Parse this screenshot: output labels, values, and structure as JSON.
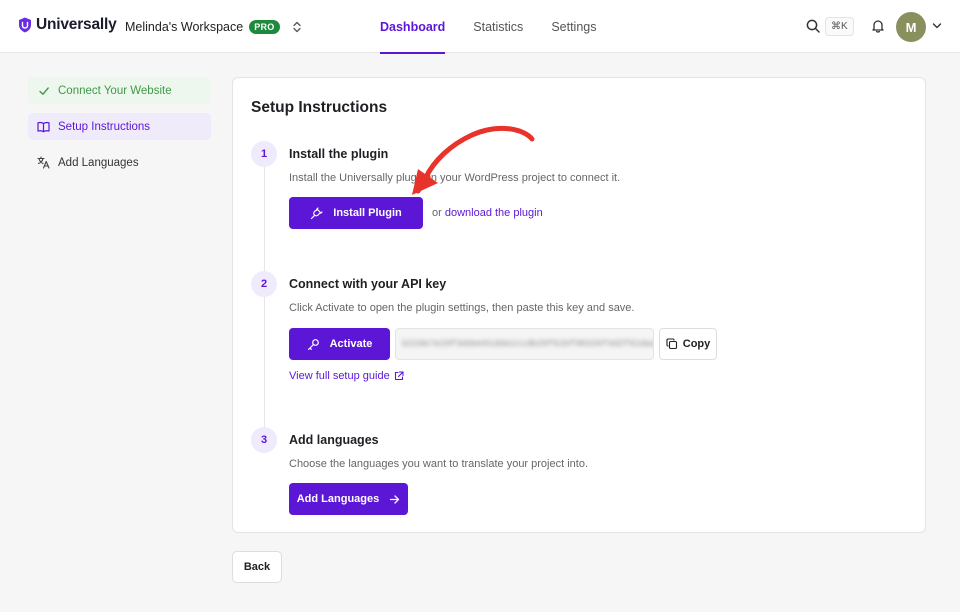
{
  "app": {
    "name": "Universally",
    "brand_color": "#5b16d6"
  },
  "workspace": {
    "name": "Melinda's Workspace",
    "badge": "PRO"
  },
  "nav": {
    "tabs": [
      {
        "label": "Dashboard",
        "active": true
      },
      {
        "label": "Statistics",
        "active": false
      },
      {
        "label": "Settings",
        "active": false
      }
    ]
  },
  "header": {
    "shortcut": "⌘K",
    "avatar_initial": "M"
  },
  "sidebar": {
    "items": [
      {
        "label": "Connect Your Website",
        "state": "done",
        "icon": "check-icon"
      },
      {
        "label": "Setup Instructions",
        "state": "active",
        "icon": "book-icon"
      },
      {
        "label": "Add Languages",
        "state": "default",
        "icon": "translate-icon"
      }
    ]
  },
  "main": {
    "title": "Setup Instructions",
    "steps": [
      {
        "number": "1",
        "title": "Install the plugin",
        "description": "Install the Universally plugin in your WordPress project to connect it.",
        "button_label": "Install Plugin",
        "alt_prefix": "or",
        "alt_link": "download the plugin"
      },
      {
        "number": "2",
        "title": "Connect with your API key",
        "description": "Click Activate to open the plugin settings, then paste this key and save.",
        "button_label": "Activate",
        "api_key": "b22de7e29f3ddee91dda1ccdb29f61bf98326f4d2f91daa7b",
        "copy_label": "Copy",
        "guide_link": "View full setup guide"
      },
      {
        "number": "3",
        "title": "Add languages",
        "description": "Choose the languages you want to translate your project into.",
        "button_label": "Add Languages"
      }
    ],
    "back_label": "Back"
  }
}
